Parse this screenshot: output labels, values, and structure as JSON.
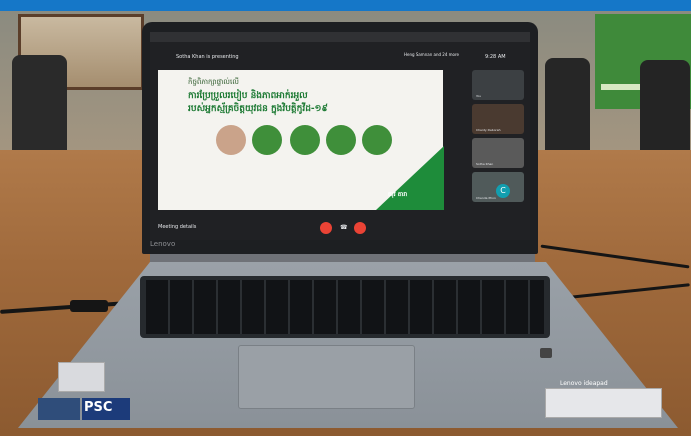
{
  "screen": {
    "presenter_text": "Sotha Khan is presenting",
    "participants_text": "Heng Samnan and 24 more",
    "time": "9:28 AM",
    "meeting_details": "Meeting details",
    "tiles": [
      {
        "name": "You"
      },
      {
        "name": "Chanty Deborah"
      },
      {
        "name": "Sotha Khan"
      },
      {
        "name": "Chenda Phon"
      }
    ],
    "avatar_letter": "C"
  },
  "slide": {
    "line1": "កិច្ចពិភាក្សាផ្ទាល់លើ",
    "line2": "ការប្រែប្រួលរបៀប និងភាពអាក់រអួល",
    "line3": "របស់អ្នកស្ម័គ្រចិត្តយុវជន ក្នុងវិបត្តិកូវីដ-១៩",
    "logo": "យុវ តារា"
  },
  "laptop": {
    "brand": "Lenovo",
    "model": "Lenovo ideapad",
    "sticker": "PSC"
  },
  "colors": {
    "top_bar": "#1577c8",
    "slide_green": "#1e8c3a",
    "meet_red": "#ea4335"
  }
}
